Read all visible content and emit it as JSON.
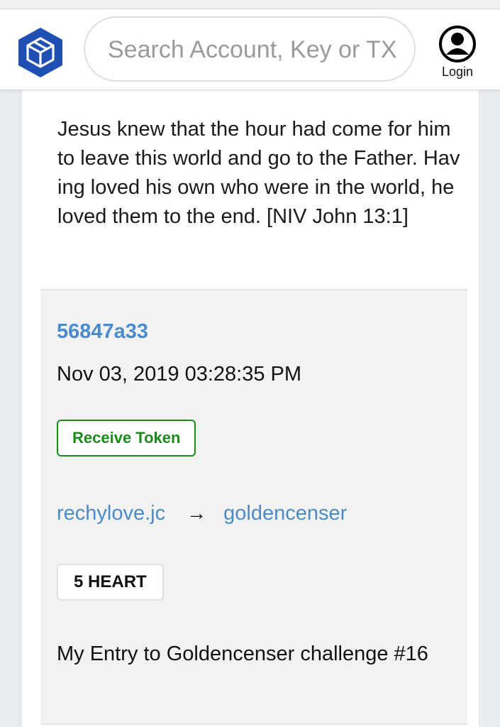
{
  "search": {
    "placeholder": "Search Account, Key or TX"
  },
  "login": {
    "label": "Login"
  },
  "entry": {
    "quote": "Jesus knew that the hour had come for him to leave this world and go to the Father. Having loved his own who were in the world, he loved them to the end. [NIV John 13:1]"
  },
  "transaction": {
    "id": "56847a33",
    "timestamp": "Nov 03, 2019 03:28:35 PM",
    "type": "Receive Token",
    "from": "rechylove.jc",
    "arrow": "→",
    "to": "goldencenser",
    "amount": "5 HEART",
    "memo": "My Entry to Goldencenser challenge #16"
  },
  "colors": {
    "link": "#4a8cc9",
    "receive_badge": "#1b8a1b",
    "logo_blue": "#1f4fb3"
  },
  "icons": {
    "logo": "cube-logo-icon",
    "user": "user-icon"
  }
}
